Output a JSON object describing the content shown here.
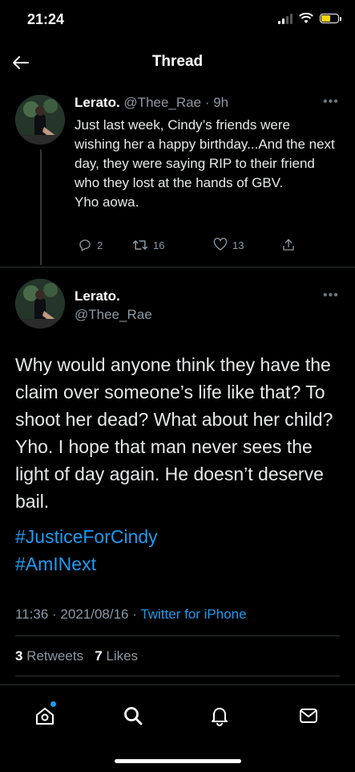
{
  "status_bar": {
    "time": "21:24"
  },
  "header": {
    "title": "Thread"
  },
  "parent_tweet": {
    "name": "Lerato.",
    "handle": "@Thee_Rae",
    "time": "· 9h",
    "lines": [
      "Just last week, Cindy’s friends were wishing her a happy birthday...And the next day, they were saying RIP to their friend who they lost at the hands of GBV.",
      "Yho aowa."
    ],
    "replies": "2",
    "retweets": "16",
    "likes": "13"
  },
  "main_tweet": {
    "name": "Lerato.",
    "handle": "@Thee_Rae",
    "text": "Why would anyone think they have the claim over someone’s life like that? To shoot her dead? What about her child? Yho. I hope that man never sees the light of day again. He doesn’t deserve bail.",
    "hashtags": [
      "#JusticeForCindy",
      "#AmINext"
    ],
    "time": "11:36",
    "date": "2021/08/16",
    "source": "Twitter for iPhone",
    "retweet_count": "3",
    "retweet_label": "Retweets",
    "like_count": "7",
    "like_label": "Likes"
  },
  "tabbar": {
    "items": [
      "home-icon",
      "search-icon",
      "notifications-icon",
      "messages-icon"
    ]
  },
  "colors": {
    "accent": "#1d9bf0",
    "muted": "#8b98a5",
    "background": "#000000"
  }
}
